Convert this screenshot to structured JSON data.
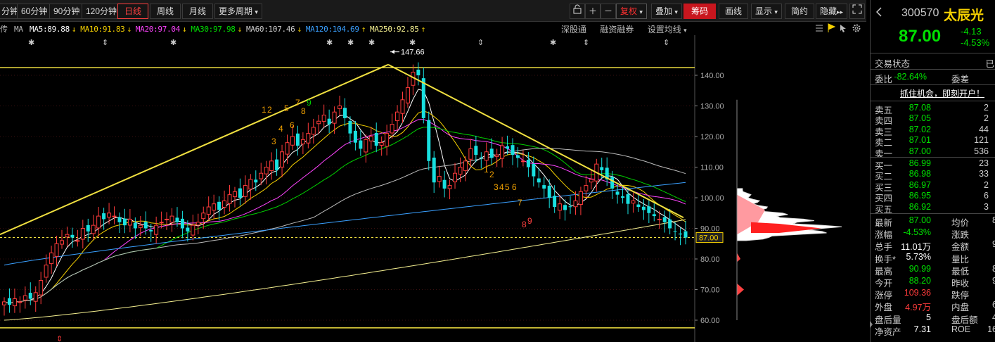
{
  "toolbar": {
    "periods": [
      "分钟",
      "60分钟",
      "90分钟",
      "120分钟",
      "日线",
      "周线",
      "月线",
      "更多周期"
    ],
    "active_period": "日线",
    "right_buttons": [
      "复权",
      "叠加",
      "筹码",
      "画线",
      "显示",
      "简约",
      "隐藏"
    ],
    "icons": [
      "lock-icon",
      "plus-icon",
      "minus-icon",
      "fullscreen-icon"
    ]
  },
  "ma_row": {
    "prefix": "传",
    "ma_label": "MA",
    "items": [
      {
        "label": "MA5:89.88",
        "arrow": "↓",
        "color": "#ffffff"
      },
      {
        "label": "MA10:91.83",
        "arrow": "↓",
        "color": "#f5d000"
      },
      {
        "label": "MA20:97.04",
        "arrow": "↓",
        "color": "#ff44ff"
      },
      {
        "label": "MA30:97.98",
        "arrow": "↓",
        "color": "#00e000"
      },
      {
        "label": "MA60:107.46",
        "arrow": "↓",
        "color": "#cccccc"
      },
      {
        "label": "MA120:104.69",
        "arrow": "↑",
        "color": "#3aa0ff"
      },
      {
        "label": "MA250:92.85",
        "arrow": "↑",
        "color": "#f5f090"
      }
    ],
    "tools": [
      "深股通",
      "融资融券",
      "设置均线"
    ]
  },
  "chart_data": {
    "type": "candlestick",
    "price_axis": {
      "ticks": [
        140,
        130,
        120,
        110,
        100,
        90,
        80,
        70,
        60
      ],
      "labels": [
        "140.00",
        "130.00",
        "120.00",
        "110.00",
        "100.00",
        "90.00",
        "80.00",
        "70.00",
        "60.00"
      ],
      "current_label": "87.00",
      "range": [
        55,
        150
      ]
    },
    "annotations": {
      "high_label": "147.66",
      "high_value": 147.66,
      "resistance_level": 142.5,
      "support_level": 57.5,
      "dashed_level": 87.0
    },
    "td_counts_up": [
      "1",
      "2",
      "3",
      "4",
      "5",
      "6",
      "7",
      "8",
      "9"
    ],
    "td_counts_down": [
      "1",
      "2",
      "3",
      "4",
      "5",
      "6",
      "7",
      "8",
      "9"
    ],
    "closes": [
      66,
      65,
      67,
      66,
      68,
      67,
      69,
      73,
      78,
      82,
      85,
      86,
      88,
      87,
      86,
      90,
      89,
      91,
      94,
      93,
      95,
      94,
      92,
      91,
      93,
      90,
      91,
      90,
      89,
      91,
      92,
      93,
      94,
      92,
      90,
      89,
      91,
      92,
      95,
      97,
      98,
      96,
      99,
      101,
      102,
      100,
      104,
      106,
      105,
      108,
      110,
      112,
      109,
      115,
      118,
      120,
      117,
      119,
      121,
      123,
      125,
      127,
      124,
      128,
      130,
      126,
      121,
      118,
      116,
      119,
      120,
      117,
      118,
      121,
      124,
      128,
      132,
      136,
      141,
      140,
      126,
      112,
      105,
      107,
      103,
      104,
      108,
      110,
      112,
      116,
      114,
      113,
      115,
      113,
      114,
      117,
      116,
      114,
      113,
      112,
      110,
      107,
      105,
      103,
      100,
      97,
      98,
      96,
      97,
      99,
      102,
      104,
      106,
      111,
      109,
      106,
      103,
      101,
      100,
      98,
      99,
      97,
      96,
      95,
      94,
      93,
      92,
      90,
      89,
      88,
      87
    ],
    "volume_profile_note": "筹码分布"
  },
  "sidebar": {
    "code": "300570",
    "name": "太辰光",
    "price": "87.00",
    "change": "-4.13",
    "change_pct": "-4.53%",
    "status_label": "交易状态",
    "status_value": "已",
    "weibi_label": "委比",
    "weibi_value": "-82.64%",
    "weicha_label": "委差",
    "promo": "抓住机会，即刻开户！",
    "asks": [
      {
        "label": "卖五",
        "price": "87.08",
        "vol": "2"
      },
      {
        "label": "卖四",
        "price": "87.05",
        "vol": "2"
      },
      {
        "label": "卖三",
        "price": "87.02",
        "vol": "44"
      },
      {
        "label": "卖二",
        "price": "87.01",
        "vol": "121"
      },
      {
        "label": "卖一",
        "price": "87.00",
        "vol": "536"
      }
    ],
    "bids": [
      {
        "label": "买一",
        "price": "86.99",
        "vol": "23"
      },
      {
        "label": "买二",
        "price": "86.98",
        "vol": "33"
      },
      {
        "label": "买三",
        "price": "86.97",
        "vol": "2"
      },
      {
        "label": "买四",
        "price": "86.95",
        "vol": "6"
      },
      {
        "label": "买五",
        "price": "86.92",
        "vol": "3"
      }
    ],
    "stats": [
      {
        "l": "最新",
        "v": "87.00",
        "vc": "green",
        "l2": "均价",
        "v2": "8"
      },
      {
        "l": "涨幅",
        "v": "-4.53%",
        "vc": "green",
        "l2": "涨跌",
        "v2": ""
      },
      {
        "l": "总手",
        "v": "11.01万",
        "vc": "white",
        "l2": "金额",
        "v2": "9"
      },
      {
        "l": "换手*",
        "v": "5.73%",
        "vc": "white",
        "l2": "量比",
        "v2": ""
      },
      {
        "l": "最高",
        "v": "90.99",
        "vc": "green",
        "l2": "最低",
        "v2": "8"
      },
      {
        "l": "今开",
        "v": "88.20",
        "vc": "green",
        "l2": "昨收",
        "v2": "9"
      },
      {
        "l": "涨停",
        "v": "109.36",
        "vc": "red",
        "l2": "跌停",
        "v2": ""
      },
      {
        "l": "外盘",
        "v": "4.97万",
        "vc": "red",
        "l2": "内盘",
        "v2": "6"
      },
      {
        "l": "盘后量",
        "v": "5",
        "vc": "white",
        "l2": "盘后额",
        "v2": "4"
      },
      {
        "l": "净资产",
        "v": "7.31",
        "vc": "white",
        "l2": "ROE",
        "v2": "16"
      }
    ]
  }
}
